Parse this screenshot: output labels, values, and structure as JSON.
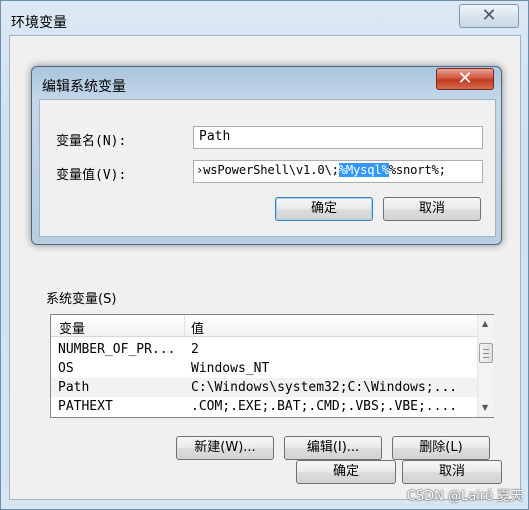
{
  "outer": {
    "title": "环境变量",
    "close_glyph": "✕",
    "system_vars_label": "系统变量(S)",
    "columns": {
      "variable": "变量",
      "value": "值"
    },
    "rows": [
      {
        "name": "NUMBER_OF_PR...",
        "value": "2"
      },
      {
        "name": "OS",
        "value": "Windows_NT"
      },
      {
        "name": "Path",
        "value": "C:\\Windows\\system32;C:\\Windows;..."
      },
      {
        "name": "PATHEXT",
        "value": ".COM;.EXE;.BAT;.CMD;.VBS;.VBE;...."
      }
    ],
    "buttons": {
      "new": "新建(W)...",
      "edit": "编辑(I)...",
      "delete": "删除(L)",
      "ok": "确定",
      "cancel": "取消"
    }
  },
  "dialog": {
    "title": "编辑系统变量",
    "close_glyph": "✕",
    "name_label": "变量名(N):",
    "value_label": "变量值(V):",
    "name_value": "Path",
    "value_before": "›wsPowerShell\\v1.0\\;",
    "value_selected": "%Mysql%",
    "value_after": "%snort%;",
    "ok": "确定",
    "cancel": "取消"
  },
  "watermark": "CSDN @Lairé 夏天"
}
